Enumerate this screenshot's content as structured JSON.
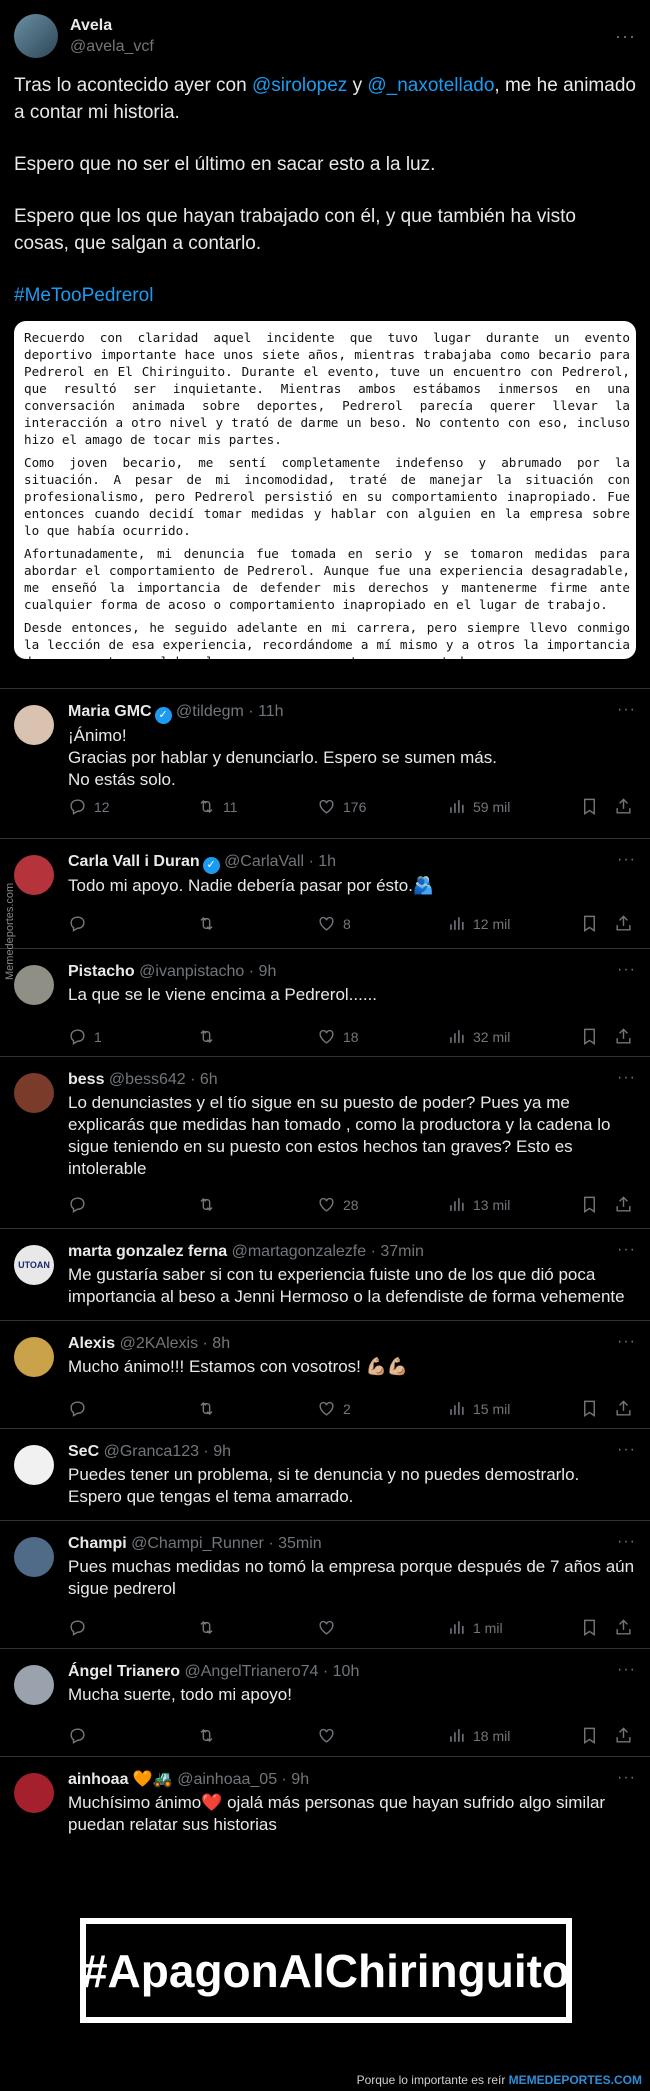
{
  "main_post": {
    "display_name": "Avela",
    "handle": "@avela_vcf",
    "text_1a": "Tras lo acontecido ayer con ",
    "mention_1": "@sirolopez",
    "text_1b": " y ",
    "mention_2": "@_naxotellado",
    "text_1c": ", me he animado a contar mi historia.",
    "text_2": "Espero que no ser el último en sacar esto a la luz.",
    "text_3": "Espero que los que hayan trabajado con él, y que también ha visto cosas, que salgan a contarlo.",
    "hashtag": "#MeTooPedrerol",
    "document": [
      "Recuerdo con claridad aquel incidente que tuvo lugar durante un evento deportivo importante hace unos siete años, mientras trabajaba como becario para Pedrerol en El Chiringuito. Durante el evento, tuve un encuentro con Pedrerol, que resultó ser inquietante. Mientras ambos estábamos inmersos en una conversación animada sobre deportes, Pedrerol parecía querer llevar la interacción a otro nivel y trató de darme un beso. No contento con eso, incluso hizo el amago de tocar mis partes.",
      "Como joven becario, me sentí completamente indefenso y abrumado por la situación. A pesar de mi incomodidad, traté de manejar la situación con profesionalismo, pero Pedrerol persistió en su comportamiento inapropiado. Fue entonces cuando decidí tomar medidas y hablar con alguien en la empresa sobre lo que había ocurrido.",
      "Afortunadamente, mi denuncia fue tomada en serio y se tomaron medidas para abordar el comportamiento de Pedrerol. Aunque fue una experiencia desagradable, me enseñó la importancia de defender mis derechos y mantenerme firme ante cualquier forma de acoso o comportamiento inapropiado en el lugar de trabajo.",
      "Desde entonces, he seguido adelante en mi carrera, pero siempre llevo conmigo la lección de esa experiencia, recordándome a mí mismo y a otros la importancia de crear entornos laborales seguros y respetuosos para todos."
    ]
  },
  "replies": [
    {
      "name": "Maria GMC",
      "verified": true,
      "meta": "@tildegm · 11h",
      "text": "¡Ánimo!\nGracias por hablar y denunciarlo. Espero se sumen más.\nNo estás solo.",
      "replies": "12",
      "retweets": "11",
      "likes": "176",
      "views": "59 mil",
      "avatar_color": "#d9c3b0"
    },
    {
      "name": "Carla Vall i Duran",
      "verified": true,
      "meta": "@CarlaVall · 1h",
      "text": "Todo mi apoyo. Nadie debería pasar por ésto.🫂",
      "replies": "",
      "retweets": "",
      "likes": "8",
      "views": "12 mil",
      "avatar_color": "#b5333b"
    },
    {
      "name": "Pistacho",
      "verified": false,
      "meta": "@ivanpistacho · 9h",
      "text": "La que se le viene encima a Pedrerol......",
      "replies": "1",
      "retweets": "",
      "likes": "18",
      "views": "32 mil",
      "avatar_color": "#8f8f86"
    },
    {
      "name": "bess",
      "verified": false,
      "meta": "@bess642 · 6h",
      "text": "Lo denunciastes y el tío sigue en su puesto de poder? Pues ya me explicarás que medidas han tomado , como la productora y la cadena lo sigue teniendo en su puesto con estos hechos tan graves? Esto es intolerable",
      "replies": "",
      "retweets": "",
      "likes": "28",
      "views": "13 mil",
      "avatar_color": "#7a3b2a"
    },
    {
      "name": "marta gonzalez ferna",
      "verified": false,
      "meta": "@martagonzalezfe · 37min",
      "text": "Me gustaría saber si con tu experiencia fuiste uno de los que dió poca importancia al beso a Jenni Hermoso o la defendiste de forma vehemente",
      "replies": "",
      "retweets": "",
      "likes": "",
      "views": "",
      "avatar_color": "#e8e8e8",
      "avatar_text": "UTOAN"
    },
    {
      "name": "Alexis",
      "verified": false,
      "meta": "@2KAlexis · 8h",
      "text": "Mucho ánimo!!! Estamos con vosotros! 💪🏼💪🏼",
      "replies": "",
      "retweets": "",
      "likes": "2",
      "views": "15 mil",
      "avatar_color": "#c9a24a"
    },
    {
      "name": "SeC",
      "verified": false,
      "meta": "@Granca123 · 9h",
      "text": "Puedes tener un problema, si te denuncia y no puedes demostrarlo. Espero que tengas el tema amarrado.",
      "replies": "",
      "retweets": "",
      "likes": "",
      "views": "",
      "avatar_color": "#f1f1f1"
    },
    {
      "name": "Champi",
      "verified": false,
      "meta": "@Champi_Runner · 35min",
      "text": "Pues muchas medidas no tomó la empresa porque después de 7 años aún sigue pedrerol",
      "replies": "",
      "retweets": "",
      "likes": "",
      "views": "1 mil",
      "avatar_color": "#4f6b88"
    },
    {
      "name": "Ángel Trianero",
      "verified": false,
      "meta": "@AngelTrianero74 · 10h",
      "text": "Mucha suerte, todo mi apoyo!",
      "replies": "",
      "retweets": "",
      "likes": "",
      "views": "18 mil",
      "avatar_color": "#9aa3ad"
    },
    {
      "name": "ainhoaa 🧡🚜",
      "verified": false,
      "meta": "@ainhoaa_05 · 9h",
      "text": "Muchísimo ánimo❤️ ojalá más personas que hayan sufrido algo similar puedan relatar sus historias",
      "replies": "",
      "retweets": "",
      "likes": "",
      "views": "",
      "avatar_color": "#a4202d"
    }
  ],
  "watermark": "Memedeportes.com",
  "banner": "#ApagonAlChiringuito",
  "footer_a": "Porque lo importante es reír ",
  "footer_b": "MEMEDEPORTES.COM"
}
